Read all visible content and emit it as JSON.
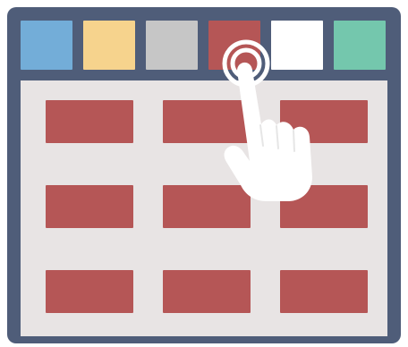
{
  "palette": {
    "frame": "#4f5d79",
    "canvas": "#e8e4e4",
    "block": "#b55656",
    "hand": "#ffffff"
  },
  "swatches": [
    {
      "name": "blue-swatch",
      "color": "#73add8"
    },
    {
      "name": "yellow-swatch",
      "color": "#f6d38d"
    },
    {
      "name": "gray-swatch",
      "color": "#c6c6c6"
    },
    {
      "name": "red-swatch",
      "color": "#b55656"
    },
    {
      "name": "white-swatch",
      "color": "#ffffff"
    },
    {
      "name": "green-swatch",
      "color": "#74c7ad"
    }
  ],
  "grid": {
    "rows": 3,
    "columns": 3,
    "blocks": [
      {
        "name": "block-r1-c1"
      },
      {
        "name": "block-r1-c2"
      },
      {
        "name": "block-r1-c3"
      },
      {
        "name": "block-r2-c1"
      },
      {
        "name": "block-r2-c2"
      },
      {
        "name": "block-r2-c3"
      },
      {
        "name": "block-r3-c1"
      },
      {
        "name": "block-r3-c2"
      },
      {
        "name": "block-r3-c3"
      }
    ]
  },
  "icons": {
    "hand": "tap-hand-icon",
    "touch": "touch-ripple-icon"
  }
}
